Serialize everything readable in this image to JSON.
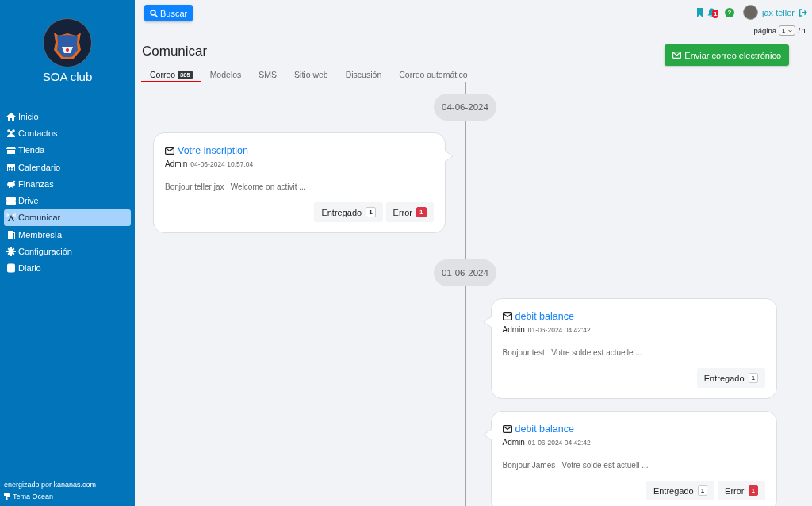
{
  "sidebar": {
    "club_name": "SOA club",
    "items": [
      {
        "label": "Inicio",
        "selected": false
      },
      {
        "label": "Contactos",
        "selected": false
      },
      {
        "label": "Tienda",
        "selected": false
      },
      {
        "label": "Calendario",
        "selected": false
      },
      {
        "label": "Finanzas",
        "selected": false
      },
      {
        "label": "Drive",
        "selected": false
      },
      {
        "label": "Comunicar",
        "selected": true
      },
      {
        "label": "Membresía",
        "selected": false
      },
      {
        "label": "Configuración",
        "selected": false
      },
      {
        "label": "Diario",
        "selected": false
      }
    ],
    "powered_by": "energizado por kananas.com",
    "theme": "Tema Ocean"
  },
  "topbar": {
    "search_button": "Buscar",
    "notification_count": "1",
    "help": "?",
    "user_name": "jax teller",
    "page_label": "página",
    "page_value": "1",
    "page_total": "/ 1"
  },
  "page_title": "Comunicar",
  "send_button": "Enviar correo electrónico",
  "tabs": [
    {
      "label": "Correo",
      "count": "385",
      "selected": true
    },
    {
      "label": "Modelos",
      "selected": false
    },
    {
      "label": "SMS",
      "selected": false
    },
    {
      "label": "Sitio web",
      "selected": false
    },
    {
      "label": "Discusión",
      "selected": false
    },
    {
      "label": "Correo automático",
      "selected": false
    }
  ],
  "timeline": [
    {
      "date": "04-06-2024",
      "messages": [
        {
          "kind": "left",
          "subject": "Votre inscription",
          "author": "Admin",
          "datetime": "04-06-2024 10:57:04",
          "preview": "Bonjour teller jax   Welcome on activit ...",
          "statuses": [
            {
              "kind": "delivered",
              "label": "Entregado",
              "count": "1"
            },
            {
              "kind": "error",
              "label": "Error",
              "count": "1"
            }
          ]
        }
      ]
    },
    {
      "date": "01-06-2024",
      "messages": [
        {
          "kind": "right",
          "subject": "debit balance",
          "author": "Admin",
          "datetime": "01-06-2024 04:42:42",
          "preview": "Bonjour test   Votre solde est actuelle ...",
          "statuses": [
            {
              "kind": "delivered",
              "label": "Entregado",
              "count": "1"
            }
          ]
        },
        {
          "kind": "right",
          "subject": "debit balance",
          "author": "Admin",
          "datetime": "01-06-2024 04:42:42",
          "preview": "Bonjour James   Votre solde est actuell ...",
          "statuses": [
            {
              "kind": "delivered",
              "label": "Entregado",
              "count": "1"
            },
            {
              "kind": "error",
              "label": "Error",
              "count": "1"
            }
          ]
        }
      ]
    }
  ]
}
